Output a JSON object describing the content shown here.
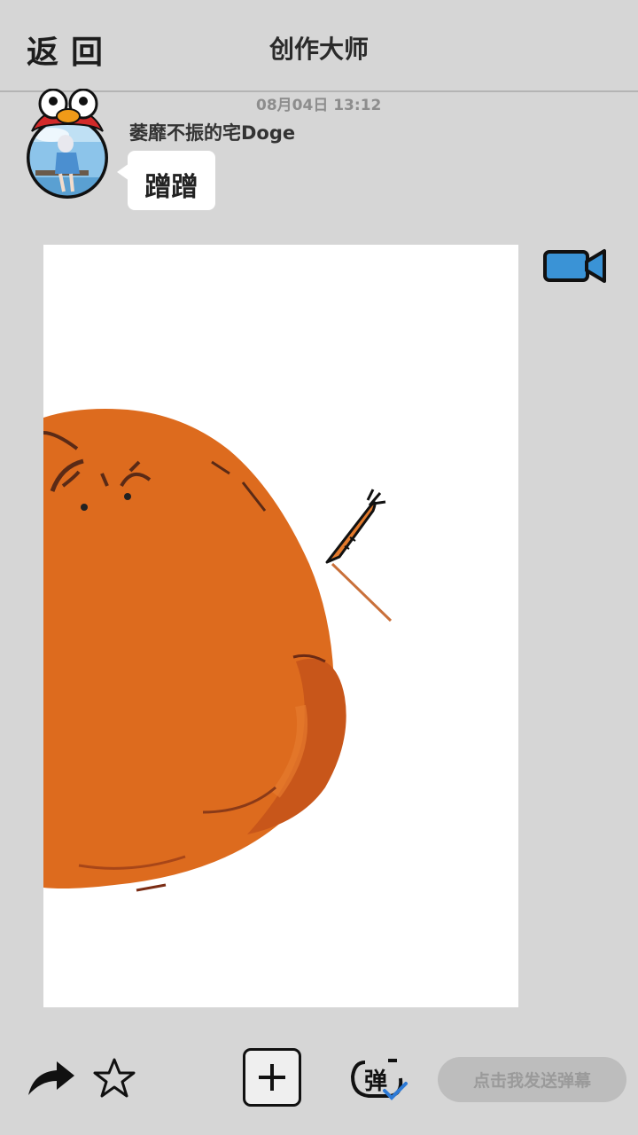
{
  "header": {
    "back_label": "返回",
    "title": "创作大师"
  },
  "post": {
    "timestamp": "08月04日  13:12",
    "username": "萎靡不振的宅Doge",
    "message": "蹭蹭"
  },
  "canvas": {
    "drawing_subject": "orange-blob-with-carrot"
  },
  "bottom_bar": {
    "danmaku_placeholder": "点击我发送弹幕",
    "danmaku_badge": "弹"
  },
  "icons": {
    "back": "back-text",
    "video": "video-camera-icon",
    "share": "share-arrow-icon",
    "star": "star-icon",
    "add": "plus-icon",
    "danmaku": "danmaku-icon"
  },
  "colors": {
    "background": "#d6d6d6",
    "blob": "#dd6b1e",
    "video": "#3a93d6",
    "check": "#2d7ad6"
  }
}
